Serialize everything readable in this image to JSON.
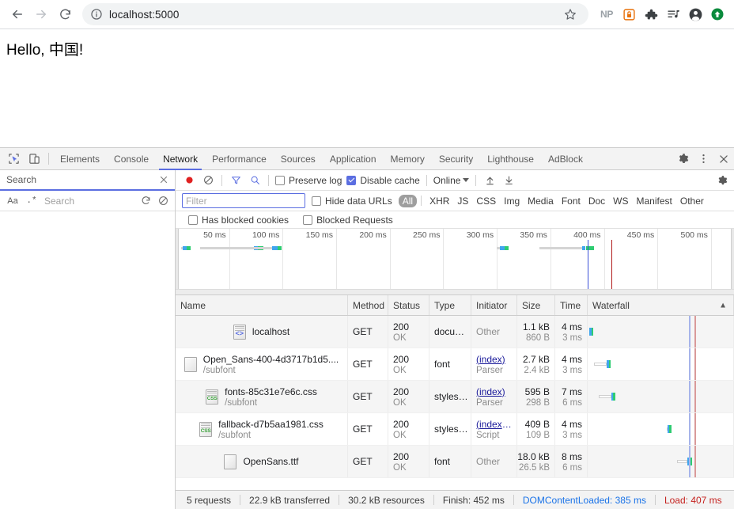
{
  "browser": {
    "back_icon": "back-arrow-icon",
    "forward_icon": "forward-arrow-icon",
    "reload_icon": "reload-icon",
    "url": "localhost:5000",
    "info_icon": "page-info-icon",
    "star_icon": "bookmark-star-icon",
    "extensions": [
      {
        "name": "np-extension-icon",
        "label": "NP"
      },
      {
        "name": "lock-extension-icon",
        "label": ""
      },
      {
        "name": "puzzle-extensions-icon",
        "label": ""
      },
      {
        "name": "playlist-extension-icon",
        "label": ""
      },
      {
        "name": "profile-avatar-icon",
        "label": ""
      },
      {
        "name": "update-button-icon",
        "label": ""
      }
    ]
  },
  "page": {
    "heading": "Hello, 中国!"
  },
  "devtools": {
    "inspect_icon": "inspect-element-icon",
    "device_icon": "device-toolbar-icon",
    "tabs": [
      {
        "label": "Elements",
        "active": false
      },
      {
        "label": "Console",
        "active": false
      },
      {
        "label": "Network",
        "active": true
      },
      {
        "label": "Performance",
        "active": false
      },
      {
        "label": "Sources",
        "active": false
      },
      {
        "label": "Application",
        "active": false
      },
      {
        "label": "Memory",
        "active": false
      },
      {
        "label": "Security",
        "active": false
      },
      {
        "label": "Lighthouse",
        "active": false
      },
      {
        "label": "AdBlock",
        "active": false
      }
    ],
    "settings_icon": "settings-gear-icon",
    "more_icon": "more-vertical-icon",
    "close_icon": "close-icon"
  },
  "search_pane": {
    "title": "Search",
    "close_icon": "close-icon",
    "match_case_label": "Aa",
    "regex_label": ".*",
    "input_placeholder": "Search",
    "input_value": "",
    "refresh_icon": "refresh-icon",
    "clear_icon": "clear-icon"
  },
  "network_toolbar": {
    "record_icon": "record-button-icon",
    "clear_icon": "clear-network-icon",
    "filter_icon": "filter-funnel-icon",
    "search_icon": "search-icon",
    "preserve_log_label": "Preserve log",
    "preserve_log_checked": false,
    "disable_cache_label": "Disable cache",
    "disable_cache_checked": true,
    "throttle_value": "Online",
    "import_icon": "import-har-icon",
    "export_icon": "export-har-icon",
    "settings_icon": "network-settings-gear-icon"
  },
  "filter_bar": {
    "filter_placeholder": "Filter",
    "filter_value": "",
    "hide_data_urls_label": "Hide data URLs",
    "hide_data_urls_checked": false,
    "types": [
      "All",
      "XHR",
      "JS",
      "CSS",
      "Img",
      "Media",
      "Font",
      "Doc",
      "WS",
      "Manifest",
      "Other"
    ],
    "active_type": "All",
    "has_blocked_cookies_label": "Has blocked cookies",
    "has_blocked_cookies_checked": false,
    "blocked_requests_label": "Blocked Requests",
    "blocked_requests_checked": false
  },
  "overview": {
    "ticks": [
      "50 ms",
      "100 ms",
      "150 ms",
      "200 ms",
      "250 ms",
      "300 ms",
      "350 ms",
      "400 ms",
      "450 ms",
      "500 ms"
    ],
    "dom_content_loaded_ms": 385,
    "load_ms": 407,
    "max_ms": 520
  },
  "table": {
    "columns": [
      "Name",
      "Method",
      "Status",
      "Type",
      "Initiator",
      "Size",
      "Time",
      "Waterfall"
    ],
    "sort_icon": "sort-ascending-icon",
    "rows": [
      {
        "icon": "document-file-icon",
        "name": "localhost",
        "path": "",
        "method": "GET",
        "status": "200",
        "status_text": "OK",
        "type": "docu…",
        "initiator": "Other",
        "initiator_sub": "",
        "initiator_is_link": false,
        "size": "1.1 kB",
        "size_sub": "860 B",
        "time": "4 ms",
        "time_sub": "3 ms"
      },
      {
        "icon": "font-file-icon",
        "name": "Open_Sans-400-4d3717b1d5....",
        "path": "/subfont",
        "method": "GET",
        "status": "200",
        "status_text": "OK",
        "type": "font",
        "initiator": "(index)",
        "initiator_sub": "Parser",
        "initiator_is_link": true,
        "size": "2.7 kB",
        "size_sub": "2.4 kB",
        "time": "4 ms",
        "time_sub": "3 ms"
      },
      {
        "icon": "css-file-icon",
        "name": "fonts-85c31e7e6c.css",
        "path": "/subfont",
        "method": "GET",
        "status": "200",
        "status_text": "OK",
        "type": "styles…",
        "initiator": "(index)",
        "initiator_sub": "Parser",
        "initiator_is_link": true,
        "size": "595 B",
        "size_sub": "298 B",
        "time": "7 ms",
        "time_sub": "6 ms"
      },
      {
        "icon": "css-file-icon",
        "name": "fallback-d7b5aa1981.css",
        "path": "/subfont",
        "method": "GET",
        "status": "200",
        "status_text": "OK",
        "type": "styles…",
        "initiator": "(index):…",
        "initiator_sub": "Script",
        "initiator_is_link": true,
        "size": "409 B",
        "size_sub": "109 B",
        "time": "4 ms",
        "time_sub": "3 ms"
      },
      {
        "icon": "font-file-icon",
        "name": "OpenSans.ttf",
        "path": "",
        "method": "GET",
        "status": "200",
        "status_text": "OK",
        "type": "font",
        "initiator": "Other",
        "initiator_sub": "",
        "initiator_is_link": false,
        "size": "18.0 kB",
        "size_sub": "26.5 kB",
        "time": "8 ms",
        "time_sub": "6 ms"
      }
    ]
  },
  "status_bar": {
    "requests": "5 requests",
    "transferred": "22.9 kB transferred",
    "resources": "30.2 kB resources",
    "finish": "Finish: 452 ms",
    "dom_content_loaded": "DOMContentLoaded: 385 ms",
    "load": "Load: 407 ms"
  },
  "colors": {
    "accent": "#5b6ee1",
    "dcl": "#1a73e8",
    "load": "#c5221f",
    "wait": "#cfcfcf",
    "download_blue": "#41a5ee",
    "download_green": "#2ecc71"
  }
}
